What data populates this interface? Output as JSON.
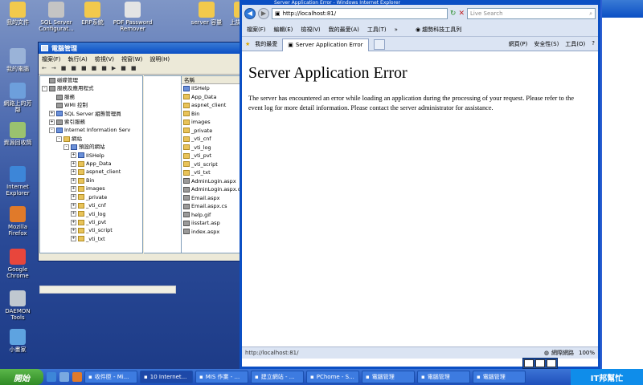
{
  "desktop": {
    "icons": [
      {
        "label": "我的文件",
        "color": "#f2c94c"
      },
      {
        "label": "我的電腦",
        "color": "#9ab3d8"
      },
      {
        "label": "網路上的芳鄰",
        "color": "#6d9fdc"
      },
      {
        "label": "資源回收筒",
        "color": "#9ac26f"
      },
      {
        "label": "Internet Explorer",
        "color": "#3d86d8"
      },
      {
        "label": "Mozilla Firefox",
        "color": "#e07a2a"
      },
      {
        "label": "Google Chrome",
        "color": "#e8463c"
      },
      {
        "label": "DAEMON Tools",
        "color": "#c0c8d0"
      },
      {
        "label": "小畫家",
        "color": "#5ea3e0"
      }
    ],
    "top_icons": [
      {
        "label": "SQL Server Configurat...",
        "color": "#c4c4c4"
      },
      {
        "label": "ERP系統",
        "color": "#f2c94c"
      },
      {
        "label": "PDF Password Remover",
        "color": "#e4e4e4"
      },
      {
        "label": "server 容量",
        "color": "#f2c94c"
      },
      {
        "label": "上課 資料",
        "color": "#f2c94c"
      }
    ]
  },
  "computer_management": {
    "title": "電腦管理",
    "menu": [
      "檔案(F)",
      "執行(A)",
      "檢視(V)",
      "視窗(W)",
      "說明(H)"
    ],
    "toolbar": [
      "←",
      "→",
      "■",
      "■",
      "■",
      "■",
      "■",
      "▶",
      "■",
      "■"
    ],
    "tree": [
      {
        "label": "磁碟管理",
        "indent": 0,
        "pm": "",
        "kind": "g"
      },
      {
        "label": "服務及應用程式",
        "indent": 0,
        "pm": "-",
        "kind": "g"
      },
      {
        "label": "服務",
        "indent": 1,
        "pm": "",
        "kind": "g"
      },
      {
        "label": "WMI 控制",
        "indent": 1,
        "pm": "",
        "kind": "g"
      },
      {
        "label": "SQL Server 組態管理員",
        "indent": 1,
        "pm": "+",
        "kind": "b"
      },
      {
        "label": "索引服務",
        "indent": 1,
        "pm": "+",
        "kind": "g"
      },
      {
        "label": "Internet Information Serv",
        "indent": 1,
        "pm": "-",
        "kind": "b"
      },
      {
        "label": "網站",
        "indent": 2,
        "pm": "-",
        "kind": "y"
      },
      {
        "label": "預設的網站",
        "indent": 3,
        "pm": "-",
        "kind": "b"
      },
      {
        "label": "IISHelp",
        "indent": 4,
        "pm": "+",
        "kind": "b"
      },
      {
        "label": "App_Data",
        "indent": 4,
        "pm": "+",
        "kind": "y"
      },
      {
        "label": "aspnet_client",
        "indent": 4,
        "pm": "+",
        "kind": "y"
      },
      {
        "label": "Bin",
        "indent": 4,
        "pm": "+",
        "kind": "y"
      },
      {
        "label": "images",
        "indent": 4,
        "pm": "+",
        "kind": "y"
      },
      {
        "label": "_private",
        "indent": 4,
        "pm": "+",
        "kind": "y"
      },
      {
        "label": "_vti_cnf",
        "indent": 4,
        "pm": "+",
        "kind": "y"
      },
      {
        "label": "_vti_log",
        "indent": 4,
        "pm": "+",
        "kind": "y"
      },
      {
        "label": "_vti_pvt",
        "indent": 4,
        "pm": "+",
        "kind": "y"
      },
      {
        "label": "_vti_script",
        "indent": 4,
        "pm": "+",
        "kind": "y"
      },
      {
        "label": "_vti_txt",
        "indent": 4,
        "pm": "+",
        "kind": "y"
      }
    ],
    "list_header": "名稱",
    "list": [
      {
        "label": "IISHelp",
        "kind": "b"
      },
      {
        "label": "App_Data",
        "kind": "y"
      },
      {
        "label": "aspnet_client",
        "kind": "y"
      },
      {
        "label": "Bin",
        "kind": "y"
      },
      {
        "label": "images",
        "kind": "y"
      },
      {
        "label": "_private",
        "kind": "y"
      },
      {
        "label": "_vti_cnf",
        "kind": "y"
      },
      {
        "label": "_vti_log",
        "kind": "y"
      },
      {
        "label": "_vti_pvt",
        "kind": "y"
      },
      {
        "label": "_vti_script",
        "kind": "y"
      },
      {
        "label": "_vti_txt",
        "kind": "y"
      },
      {
        "label": "AdminLogin.aspx",
        "kind": "g"
      },
      {
        "label": "AdminLogin.aspx.cs",
        "kind": "g"
      },
      {
        "label": "Email.aspx",
        "kind": "g"
      },
      {
        "label": "Email.aspx.cs",
        "kind": "g"
      },
      {
        "label": "help.gif",
        "kind": "g"
      },
      {
        "label": "iisstart.asp",
        "kind": "g"
      },
      {
        "label": "index.aspx",
        "kind": "g"
      }
    ]
  },
  "ie": {
    "title": "Server Application Error - Windows Internet Explorer",
    "address": "http://localhost:81/",
    "search_placeholder": "Live Search",
    "menu": [
      "檔案(F)",
      "編輯(E)",
      "檢視(V)",
      "我的最愛(A)",
      "工具(T)",
      "»"
    ],
    "toolbar_label": "趨勢科技工具列",
    "favorites_label": "我的最愛",
    "tab_title": "Server Application Error",
    "commands": [
      "網頁(P)",
      "安全性(S)",
      "工具(O)",
      "?"
    ],
    "heading": "Server Application Error",
    "body": "The server has encountered an error while loading an application during the processing of your request. Please refer to the event log for more detail information. Please contact the server administrator for assistance.",
    "status_url": "http://localhost:81/",
    "zone": "網際網路",
    "zoom": "100%"
  },
  "taskbar": {
    "start": "開始",
    "tasks": [
      {
        "label": "收件匣 - Mi...",
        "active": false
      },
      {
        "label": "10 Internet...",
        "active": true
      },
      {
        "label": "MIS 作業 - ...",
        "active": false
      },
      {
        "label": "建立網站 - ...",
        "active": false
      },
      {
        "label": "PChome - S...",
        "active": false
      },
      {
        "label": "電腦管理",
        "active": false
      },
      {
        "label": "電腦管理",
        "active": false
      },
      {
        "label": "電腦管理",
        "active": false
      }
    ],
    "tray_logo": "IT邦幫忙"
  }
}
